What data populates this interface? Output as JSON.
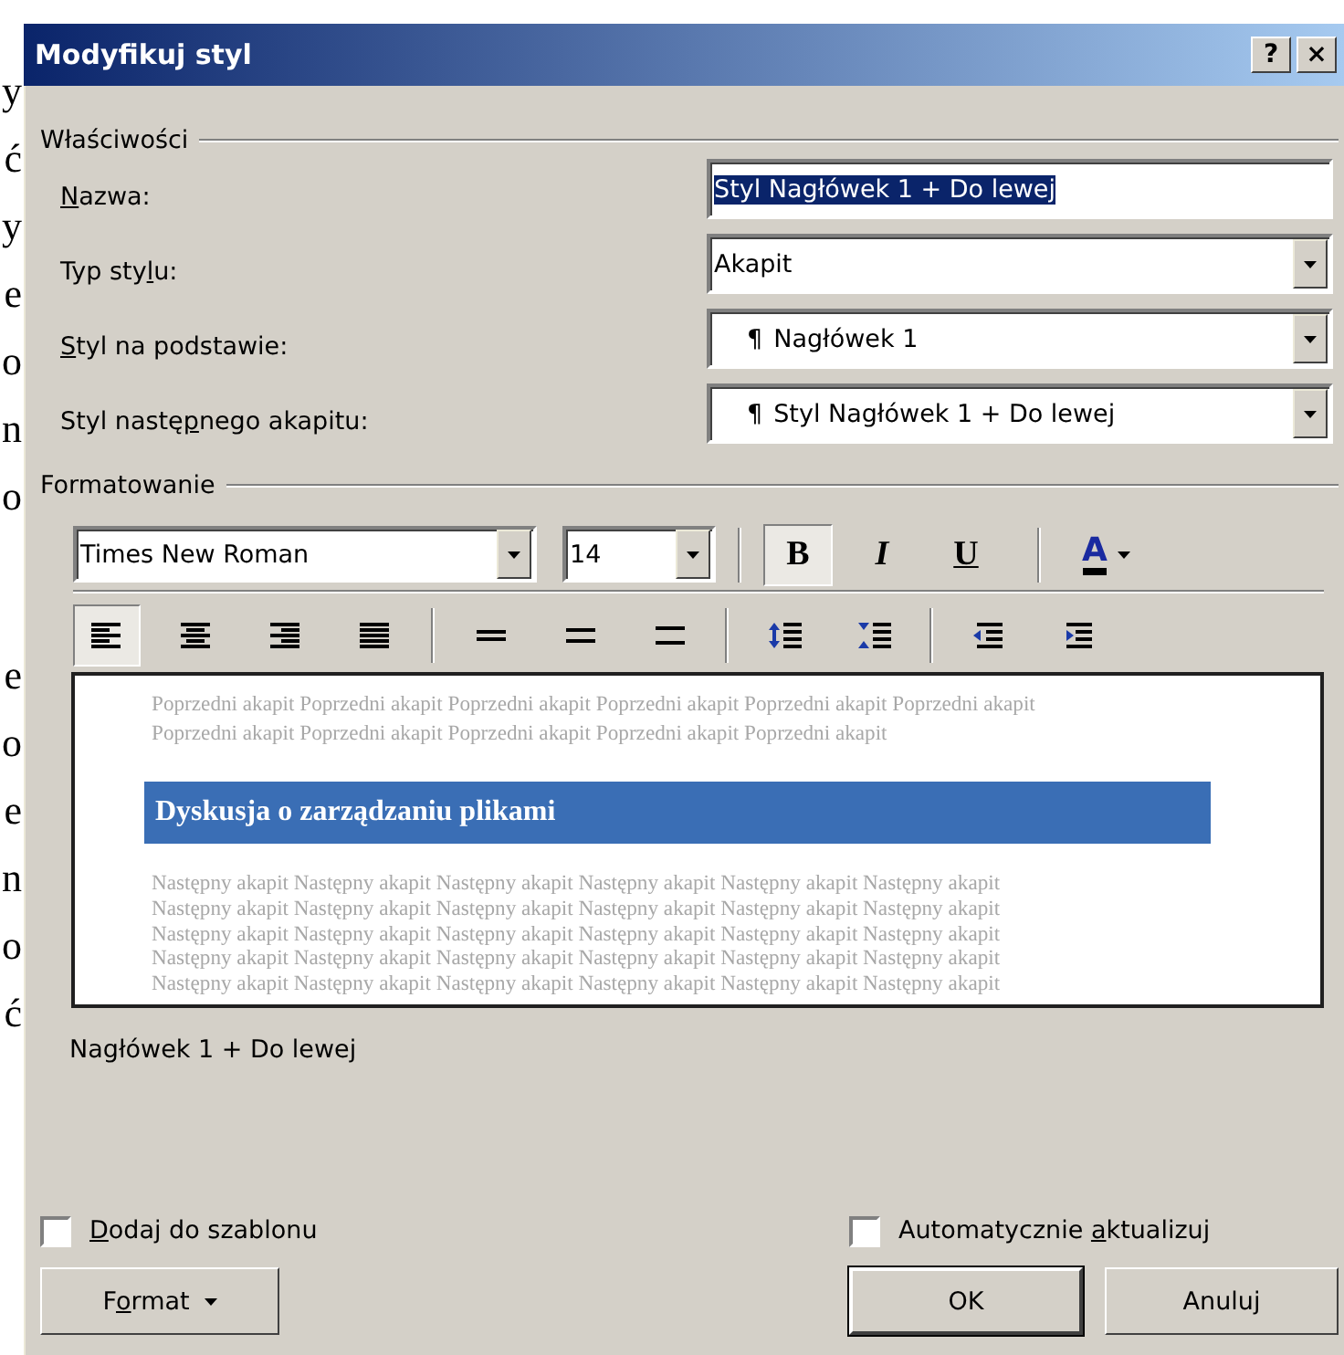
{
  "background_document": {
    "line_end_groups": [
      [
        "y",
        "ć",
        "y",
        "e",
        "o",
        "n",
        "o"
      ],
      [
        "e",
        "o",
        "e",
        "n",
        "o",
        "ć"
      ]
    ]
  },
  "window": {
    "title": "Modyfikuj styl",
    "help_button": "?",
    "close_button": "×"
  },
  "properties": {
    "legend": "Właściwości",
    "fields": [
      {
        "kind": "text",
        "label": {
          "key": "N",
          "after": "azwa:"
        },
        "value": "Styl Nagłówek 1 + Do lewej",
        "text_selected": true
      },
      {
        "kind": "dropdown",
        "label": {
          "before": "Typ sty",
          "key": "l",
          "after": "u:"
        },
        "value": "Akapit"
      },
      {
        "kind": "dropdown",
        "label": {
          "key": "S",
          "after": "tyl na podstawie:"
        },
        "mark": "¶",
        "value": "Nagłówek 1"
      },
      {
        "kind": "dropdown",
        "label": {
          "before": "Styl nastę",
          "key": "p",
          "after": "nego akapitu:"
        },
        "mark": "¶",
        "value": "Styl Nagłówek 1 + Do lewej"
      }
    ]
  },
  "formatting": {
    "legend": "Formatowanie",
    "font": "Times New Roman",
    "size": "14",
    "style_buttons": [
      {
        "kind": "bold",
        "label": "B",
        "selected": true
      },
      {
        "kind": "italic",
        "label": "I",
        "selected": false
      },
      {
        "kind": "underline",
        "label": "U",
        "selected": false
      }
    ],
    "font_color": {
      "label": "A"
    },
    "alignment": [
      {
        "kind": "left",
        "selected": true
      },
      {
        "kind": "center",
        "selected": false
      },
      {
        "kind": "right",
        "selected": false
      },
      {
        "kind": "justify",
        "selected": false
      }
    ],
    "line_spacing": [
      {
        "kind": "single",
        "selected": false
      },
      {
        "kind": "one_and_half",
        "selected": false
      },
      {
        "kind": "double",
        "selected": false
      }
    ],
    "paragraph_spacing": [
      {
        "kind": "increase"
      },
      {
        "kind": "decrease"
      }
    ],
    "indent": [
      {
        "kind": "decrease"
      },
      {
        "kind": "increase"
      }
    ]
  },
  "preview": {
    "previous_lines": [
      "Poprzedni akapit Poprzedni akapit Poprzedni akapit Poprzedni akapit Poprzedni akapit Poprzedni akapit",
      "Poprzedni akapit Poprzedni akapit Poprzedni akapit Poprzedni akapit Poprzedni akapit"
    ],
    "heading": "Dyskusja o zarządzaniu plikami",
    "next_lines": [
      "Następny akapit Następny akapit Następny akapit Następny akapit Następny akapit Następny akapit",
      "Następny akapit Następny akapit Następny akapit Następny akapit Następny akapit Następny akapit",
      "Następny akapit Następny akapit Następny akapit Następny akapit Następny akapit Następny akapit",
      "Następny akapit Następny akapit Następny akapit Następny akapit Następny akapit Następny akapit",
      "Następny akapit Następny akapit Następny akapit Następny akapit Następny akapit Następny akapit"
    ]
  },
  "description": "Nagłówek 1 + Do lewej",
  "options": [
    {
      "label": {
        "key": "D",
        "after": "odaj do szablonu"
      },
      "checked": false
    },
    {
      "label": {
        "before": "Automatycznie ",
        "key": "a",
        "after": "ktualizuj"
      },
      "checked": false
    }
  ],
  "buttons": [
    {
      "kind": "menu",
      "label": {
        "before": "F",
        "key": "o",
        "after": "rmat"
      }
    },
    {
      "kind": "default",
      "label": {
        "before": "OK"
      }
    },
    {
      "kind": "normal",
      "label": {
        "before": "Anuluj"
      }
    }
  ]
}
